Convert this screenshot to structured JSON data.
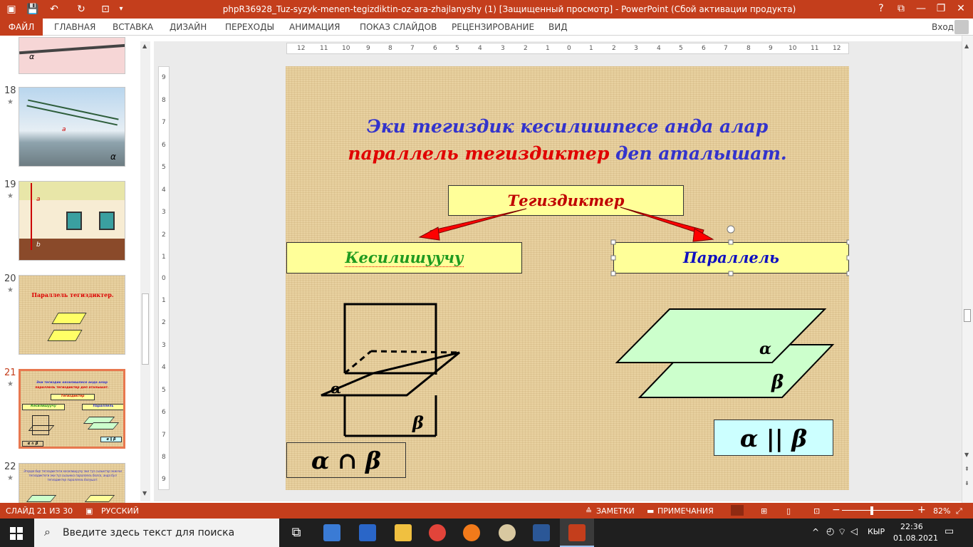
{
  "titlebar": {
    "title": "phpR36928_Tuz-syzyk-menen-tegizdiktin-oz-ara-zhajlanyshy (1) [Защищенный просмотр] -  PowerPoint (Сбой активации продукта)",
    "help": "?",
    "restore_ribbon": "⧉",
    "minimize": "—",
    "maximize": "❐",
    "close": "✕"
  },
  "ribbon": {
    "file": "ФАЙЛ",
    "tabs": [
      "ГЛАВНАЯ",
      "ВСТАВКА",
      "ДИЗАЙН",
      "ПЕРЕХОДЫ",
      "АНИМАЦИЯ",
      "ПОКАЗ СЛАЙДОВ",
      "РЕЦЕНЗИРОВАНИЕ",
      "ВИД"
    ],
    "signin": "Вход"
  },
  "thumbnails": [
    {
      "num": "18",
      "star": "★",
      "alpha": "α",
      "a": "a"
    },
    {
      "num": "19",
      "star": "★",
      "a": "a",
      "b": "b"
    },
    {
      "num": "20",
      "star": "★",
      "title": "Параллель тегиздиктер."
    },
    {
      "num": "21",
      "star": "★",
      "line1": "Эки тегиздик кесилишпесе анда алар",
      "line2": "параллель тегиздиктер деп аталышат.",
      "center": "Тегиздиктер",
      "left": "Кесилишуучу",
      "right": "Параллель",
      "sym1": "α ∩ β",
      "sym2": "α ∥ β"
    },
    {
      "num": "22",
      "star": "★",
      "text": "Эгерде бир тегиздиктеги кесилишуучу эки түз сызыктар экинчи тегиздиктеги эки түз сызыкка параллель болсо, анда бул тегиздиктер параллель болушат."
    }
  ],
  "thumb17": {
    "alpha": "α"
  },
  "ruler": {
    "h": [
      "12",
      "11",
      "10",
      "9",
      "8",
      "7",
      "6",
      "5",
      "4",
      "3",
      "2",
      "1",
      "0",
      "1",
      "2",
      "3",
      "4",
      "5",
      "6",
      "7",
      "8",
      "9",
      "10",
      "11",
      "12"
    ],
    "v": [
      "9",
      "8",
      "7",
      "6",
      "5",
      "4",
      "3",
      "2",
      "1",
      "0",
      "1",
      "2",
      "3",
      "4",
      "5",
      "6",
      "7",
      "8",
      "9"
    ]
  },
  "slide": {
    "title_line1": "Эки тегиздик кесилишпесе анда алар",
    "title_line2_red": "параллель тегиздиктер",
    "title_line2_blue": "деп аталышат.",
    "center_box": "Тегиздиктер",
    "left_box": "Кесилишуучу",
    "right_box": "Параллель",
    "alpha": "α",
    "beta": "β",
    "symbol_left": "α ∩ β",
    "symbol_right": "α || β",
    "colors": {
      "title_blue": "#3333cc",
      "title_red": "#e00000",
      "green_text": "#1f9a1f",
      "plane_fill": "#ccffcc",
      "symbol_box": "#ccffff",
      "box_fill": "#ffff99"
    }
  },
  "status": {
    "slide": "СЛАЙД 21 ИЗ 30",
    "lang": "РУССКИЙ",
    "notes": "ЗАМЕТКИ",
    "comments": "ПРИМЕЧАНИЯ",
    "zoom": "82%",
    "zoom_minus": "−",
    "zoom_plus": "+"
  },
  "taskbar": {
    "search_placeholder": "Введите здесь текст для поиска",
    "lang": "КЫР",
    "time": "22:36",
    "date": "01.08.2021"
  }
}
